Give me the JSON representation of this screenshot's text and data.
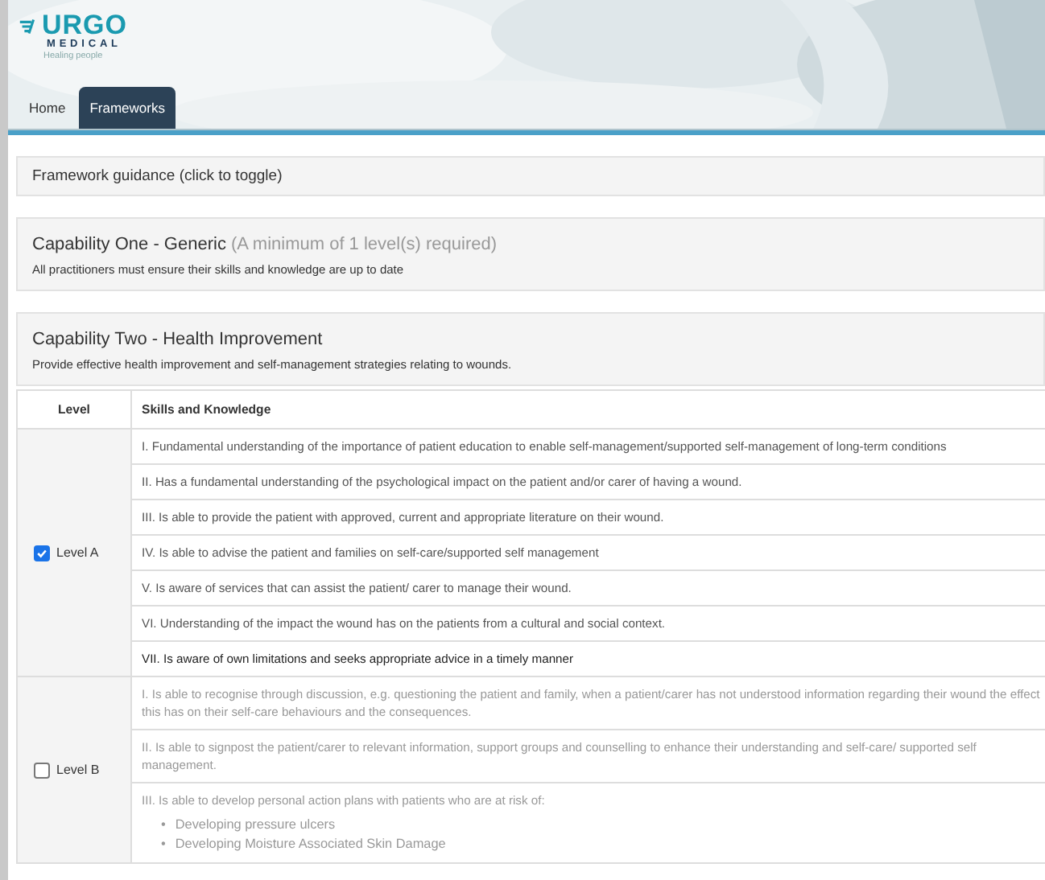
{
  "logo": {
    "brand": "URGO",
    "sub": "MEDICAL",
    "tagline": "Healing people"
  },
  "tabs": [
    {
      "label": "Home",
      "selected": false
    },
    {
      "label": "Frameworks",
      "selected": true
    }
  ],
  "guidance": {
    "label": "Framework guidance (click to toggle)"
  },
  "capabilities": [
    {
      "title": "Capability One - Generic",
      "note": "(A minimum of 1 level(s) required)",
      "description": "All practitioners must ensure their skills and knowledge are up to date"
    },
    {
      "title": "Capability Two - Health Improvement",
      "description": "Provide effective health improvement and self-management strategies relating to wounds."
    }
  ],
  "table": {
    "columns": [
      "Level",
      "Skills and Knowledge"
    ],
    "levels": [
      {
        "label": "Level A",
        "checked": true,
        "items": [
          {
            "text": "I. Fundamental understanding of the importance of patient education to enable self-management/supported self-management of long-term conditions",
            "highlighted": false
          },
          {
            "text": "II. Has a fundamental understanding of the psychological impact on the patient and/or carer of having a wound.",
            "highlighted": false
          },
          {
            "text": "III. Is able to provide the patient with approved, current and appropriate literature on their wound.",
            "highlighted": false
          },
          {
            "text": "IV. Is able to advise the patient and families on self-care/supported self management",
            "highlighted": false
          },
          {
            "text": "V. Is aware of services that can assist the patient/ carer to manage their wound.",
            "highlighted": false
          },
          {
            "text": "VI. Understanding of the impact the wound has on the patients from a cultural and social context.",
            "highlighted": false
          },
          {
            "text": "VII. Is aware of own limitations and seeks appropriate advice in a timely manner",
            "highlighted": true
          }
        ]
      },
      {
        "label": "Level B",
        "checked": false,
        "items": [
          {
            "text": "I. Is able to recognise through discussion, e.g. questioning the patient and family, when a patient/carer has not understood information regarding their wound the effect this has on their self-care behaviours and the consequences.",
            "highlighted": false
          },
          {
            "text": "II. Is able to signpost the patient/carer to relevant information, support groups and counselling to enhance their understanding and self-care/ supported self management.",
            "highlighted": false
          },
          {
            "text": "III. Is able to develop personal action plans with patients who are at risk of:",
            "highlighted": false,
            "bullets": [
              {
                "marker": "•",
                "text": "Developing pressure ulcers"
              },
              {
                "marker": "•",
                "text": "Developing Moisture Associated Skin Damage"
              }
            ]
          }
        ]
      }
    ]
  }
}
